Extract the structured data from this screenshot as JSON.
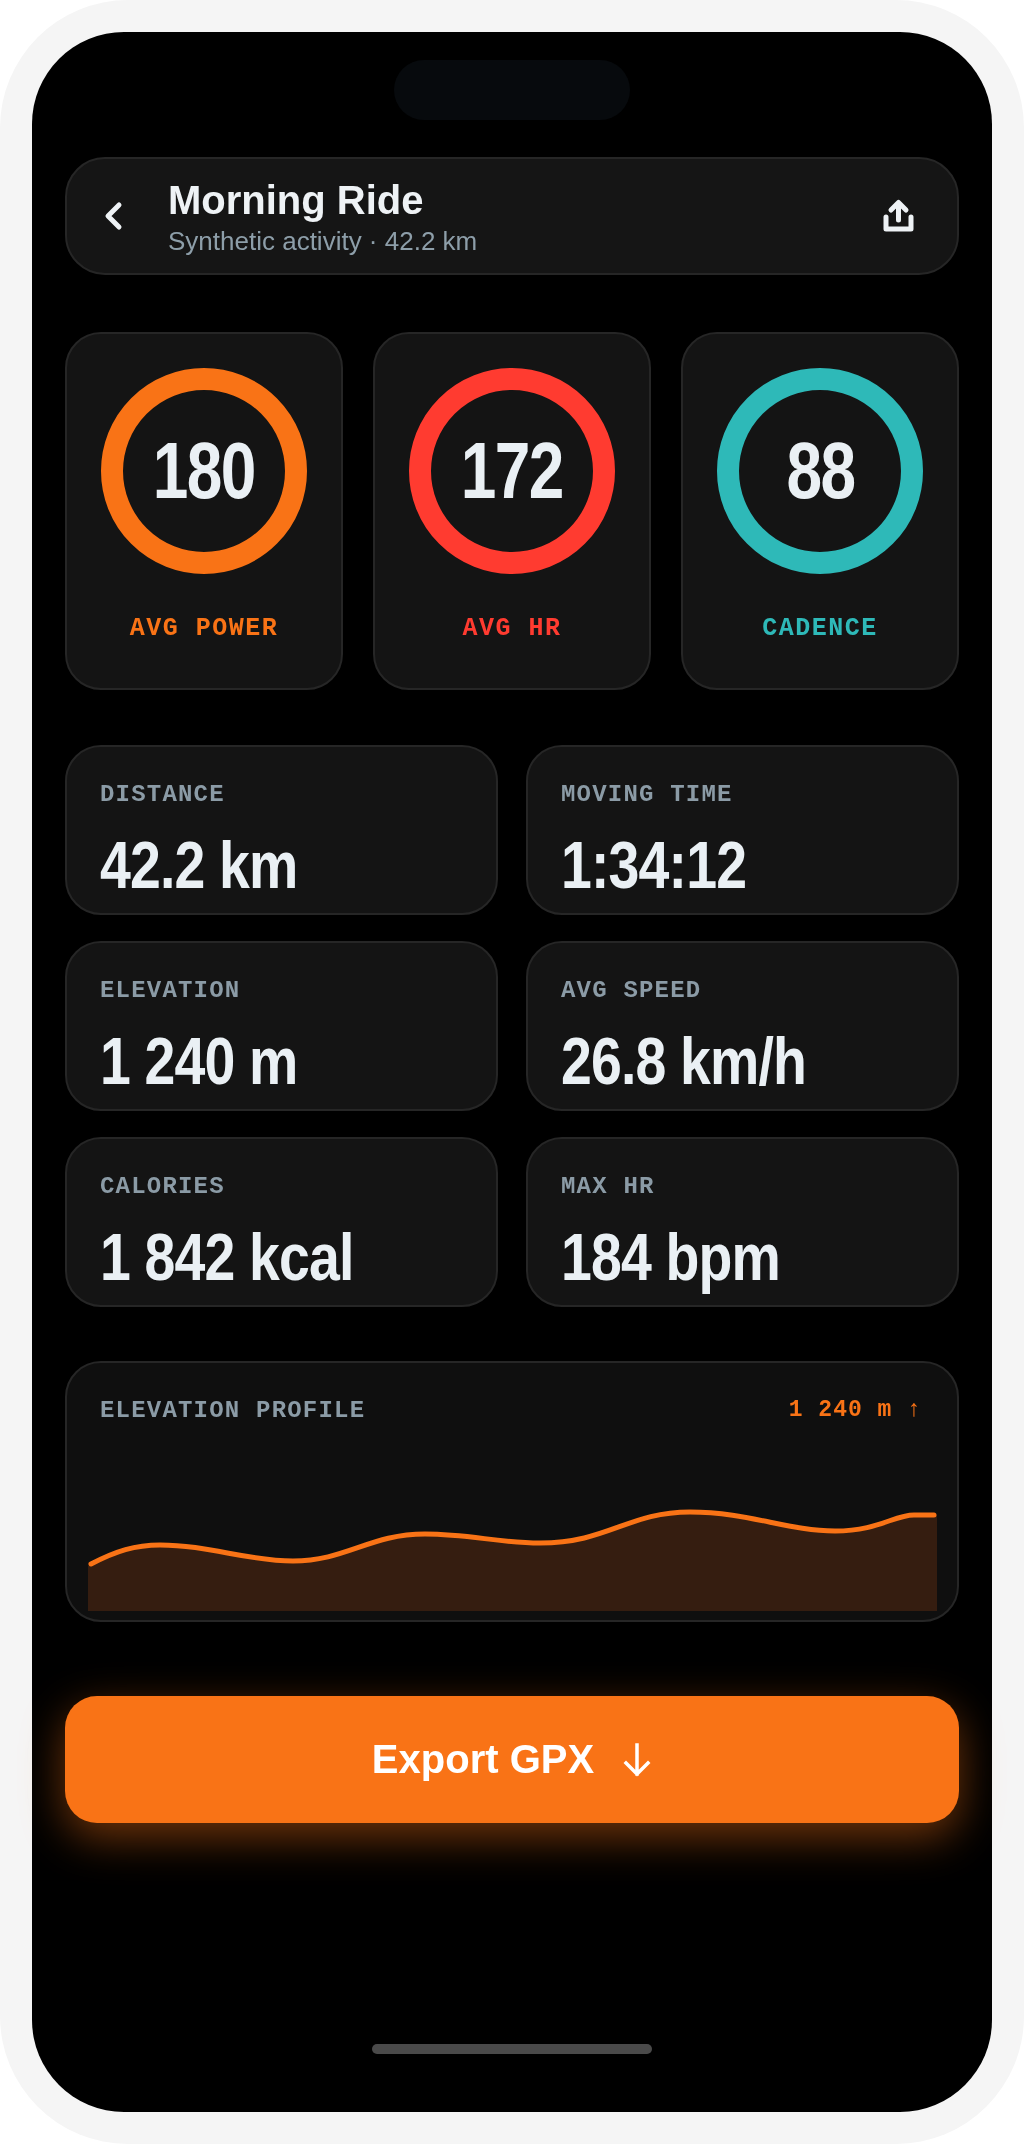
{
  "header": {
    "title": "Morning Ride",
    "subtitle": "Synthetic activity · 42.2 km"
  },
  "metrics": [
    {
      "value": "180",
      "label": "AVG POWER",
      "color": "#f97316"
    },
    {
      "value": "172",
      "label": "AVG HR",
      "color": "#ff3b30"
    },
    {
      "value": "88",
      "label": "CADENCE",
      "color": "#2eb9b8"
    }
  ],
  "stats": [
    {
      "label": "DISTANCE",
      "value": "42.2 km"
    },
    {
      "label": "MOVING TIME",
      "value": "1:34:12"
    },
    {
      "label": "ELEVATION",
      "value": "1 240 m"
    },
    {
      "label": "AVG SPEED",
      "value": "26.8 km/h"
    },
    {
      "label": "CALORIES",
      "value": "1 842 kcal"
    },
    {
      "label": "MAX HR",
      "value": "184 bpm"
    }
  ],
  "elevation_profile": {
    "title": "ELEVATION PROFILE",
    "gain": "1 240 m ↑"
  },
  "export_button": {
    "label": "Export GPX"
  }
}
